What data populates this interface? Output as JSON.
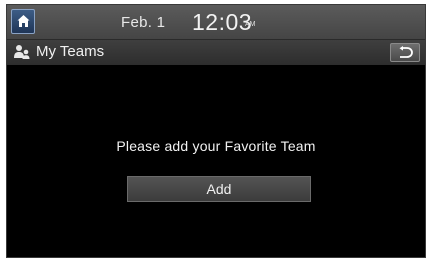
{
  "status_bar": {
    "date": "Feb.  1",
    "time": "12:03",
    "ampm": "AM",
    "home_icon": "home-icon"
  },
  "title_bar": {
    "title": "My Teams",
    "title_icon": "team-icon",
    "back_icon": "back-arrow-icon"
  },
  "content": {
    "message": "Please add your Favorite Team",
    "add_label": "Add"
  }
}
